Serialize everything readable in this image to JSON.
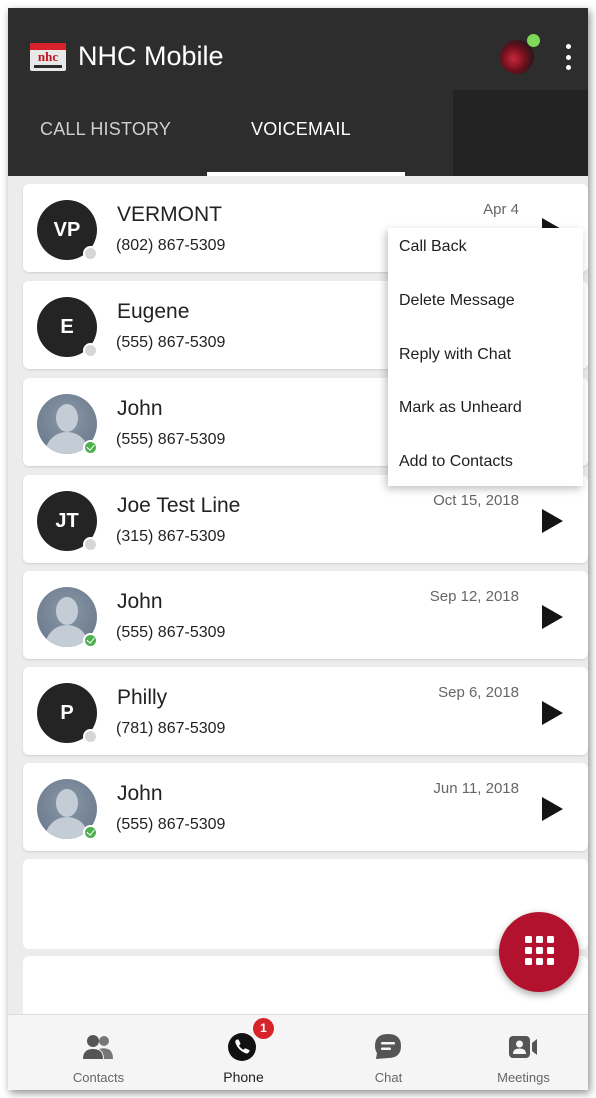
{
  "app": {
    "title": "NHC Mobile",
    "logo_text": "nhc",
    "colors": {
      "header": "#2d2d2d",
      "accent": "#b3122e",
      "online": "#4caf50",
      "offline": "#d6d6d6"
    }
  },
  "tabs": [
    {
      "label": "CALL HISTORY",
      "selected": false
    },
    {
      "label": "VOICEMAIL",
      "selected": true
    }
  ],
  "voicemails": [
    {
      "initials": "VP",
      "name": "VERMONT",
      "phone": "(802) 867-5309",
      "date": "Apr 4",
      "avatar": "initials",
      "presence": "offline"
    },
    {
      "initials": "E",
      "name": "Eugene",
      "phone": "(555) 867-5309",
      "date": "",
      "avatar": "initials",
      "presence": "offline"
    },
    {
      "initials": "",
      "name": "John",
      "phone": "(555) 867-5309",
      "date": "",
      "avatar": "photo",
      "presence": "online"
    },
    {
      "initials": "JT",
      "name": "Joe Test Line",
      "phone": "(315) 867-5309",
      "date": "Oct 15, 2018",
      "avatar": "initials",
      "presence": "offline"
    },
    {
      "initials": "",
      "name": "John",
      "phone": "(555) 867-5309",
      "date": "Sep 12, 2018",
      "avatar": "photo",
      "presence": "online"
    },
    {
      "initials": "P",
      "name": "Philly",
      "phone": "(781) 867-5309",
      "date": "Sep 6, 2018",
      "avatar": "initials",
      "presence": "offline"
    },
    {
      "initials": "",
      "name": "John",
      "phone": "(555) 867-5309",
      "date": "Jun 11, 2018",
      "avatar": "photo",
      "presence": "online"
    }
  ],
  "context_menu": {
    "items": [
      "Call Back",
      "Delete Message",
      "Reply with Chat",
      "Mark as Unheard",
      "Add to Contacts"
    ]
  },
  "fab": {
    "icon": "dialpad-icon"
  },
  "bottom_nav": {
    "items": [
      {
        "label": "Contacts",
        "icon": "contacts-icon",
        "active": false
      },
      {
        "label": "Phone",
        "icon": "phone-icon",
        "active": true,
        "badge": "1"
      },
      {
        "label": "Chat",
        "icon": "chat-icon",
        "active": false
      },
      {
        "label": "Meetings",
        "icon": "meetings-icon",
        "active": false
      }
    ]
  }
}
